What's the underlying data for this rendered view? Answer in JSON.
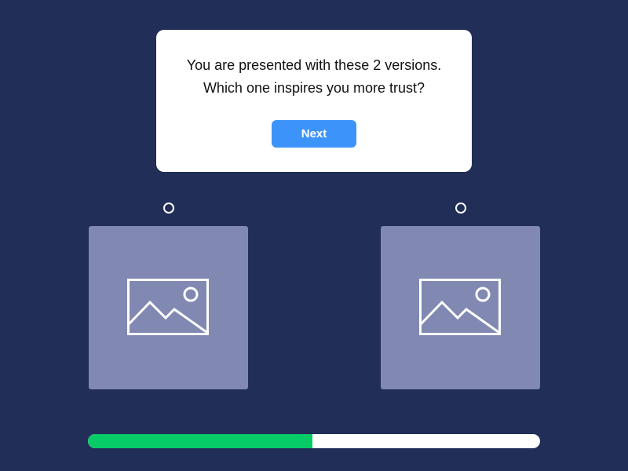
{
  "question": {
    "line1": "You are presented with these 2 versions.",
    "line2": "Which one inspires you more trust?"
  },
  "next_button": {
    "label": "Next",
    "color": "#3c94fb"
  },
  "options": [
    {
      "icon": "image-placeholder-icon",
      "selected": false
    },
    {
      "icon": "image-placeholder-icon",
      "selected": false
    }
  ],
  "progress": {
    "fraction": 0.497,
    "fill_color": "#06cb67"
  },
  "colors": {
    "background": "#212e58",
    "card": "#ffffff",
    "image_placeholder": "#8189b3"
  }
}
